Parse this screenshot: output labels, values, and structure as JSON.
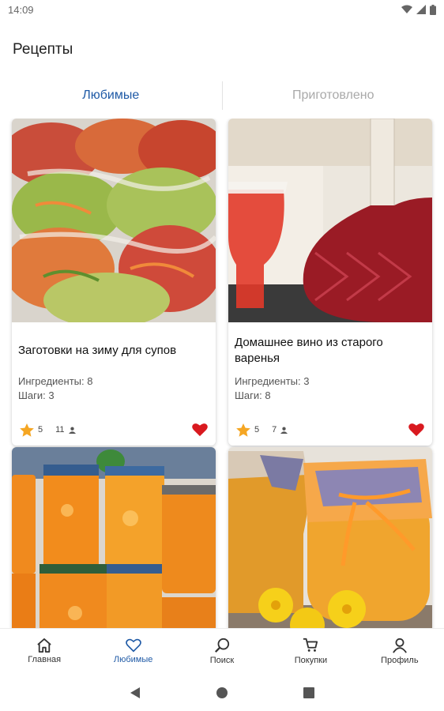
{
  "status": {
    "time": "14:09",
    "icons": [
      "wifi-icon",
      "signal-icon",
      "battery-icon"
    ]
  },
  "app": {
    "title": "Рецепты"
  },
  "tabs": [
    {
      "label": "Любимые",
      "active": true
    },
    {
      "label": "Приготовлено",
      "active": false
    }
  ],
  "recipes": [
    {
      "title": "Заготовки на зиму для супов",
      "ingredients": "Ингредиенты: 8",
      "steps": "Шаги: 3",
      "rating": "5",
      "users": "11",
      "favorite": true
    },
    {
      "title": "Домашнее вино из старого варенья",
      "ingredients": "Ингредиенты: 3",
      "steps": "Шаги: 8",
      "rating": "5",
      "users": "7",
      "favorite": true
    },
    {
      "title": "",
      "ingredients": "",
      "steps": "",
      "rating": "",
      "users": "",
      "favorite": true
    },
    {
      "title": "",
      "ingredients": "",
      "steps": "",
      "rating": "",
      "users": "",
      "favorite": true
    }
  ],
  "bottom_nav": [
    {
      "label": "Главная",
      "icon": "home-icon"
    },
    {
      "label": "Любимые",
      "icon": "heart-outline-icon",
      "active": true
    },
    {
      "label": "Поиск",
      "icon": "search-icon"
    },
    {
      "label": "Покупки",
      "icon": "cart-icon"
    },
    {
      "label": "Профиль",
      "icon": "profile-icon"
    }
  ],
  "colors": {
    "accent": "#1f5aa6",
    "inactive_tab": "#a9a9a9",
    "star": "#f5a623",
    "heart": "#d9191f"
  }
}
